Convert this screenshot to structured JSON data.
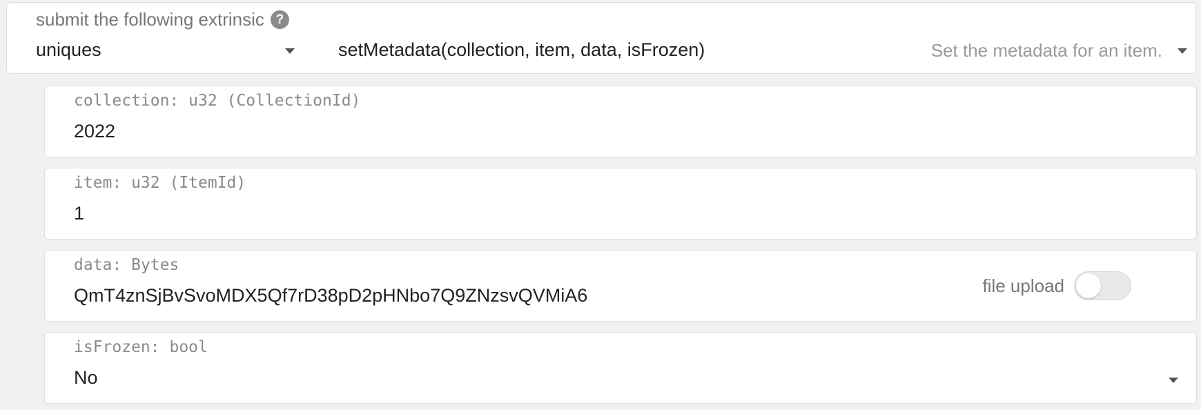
{
  "extrinsic": {
    "label": "submit the following extrinsic",
    "help_icon": "question-circle-icon",
    "section": "uniques",
    "method": "setMetadata(collection, item, data, isFrozen)",
    "description": "Set the metadata for an item."
  },
  "params": {
    "collection": {
      "label": "collection: u32 (CollectionId)",
      "value": "2022"
    },
    "item": {
      "label": "item: u32 (ItemId)",
      "value": "1"
    },
    "data": {
      "label": "data: Bytes",
      "value": "QmT4znSjBvSvoMDX5Qf7rD38pD2pHNbo7Q9ZNzsvQVMiA6",
      "toggle_label": "file upload",
      "toggle_on": false
    },
    "isFrozen": {
      "label": "isFrozen: bool",
      "value": "No"
    }
  },
  "colors": {
    "background": "#f2f1f0",
    "card": "#ffffff",
    "border": "#dedede",
    "text": "#222222",
    "muted": "#9a9a9a"
  }
}
